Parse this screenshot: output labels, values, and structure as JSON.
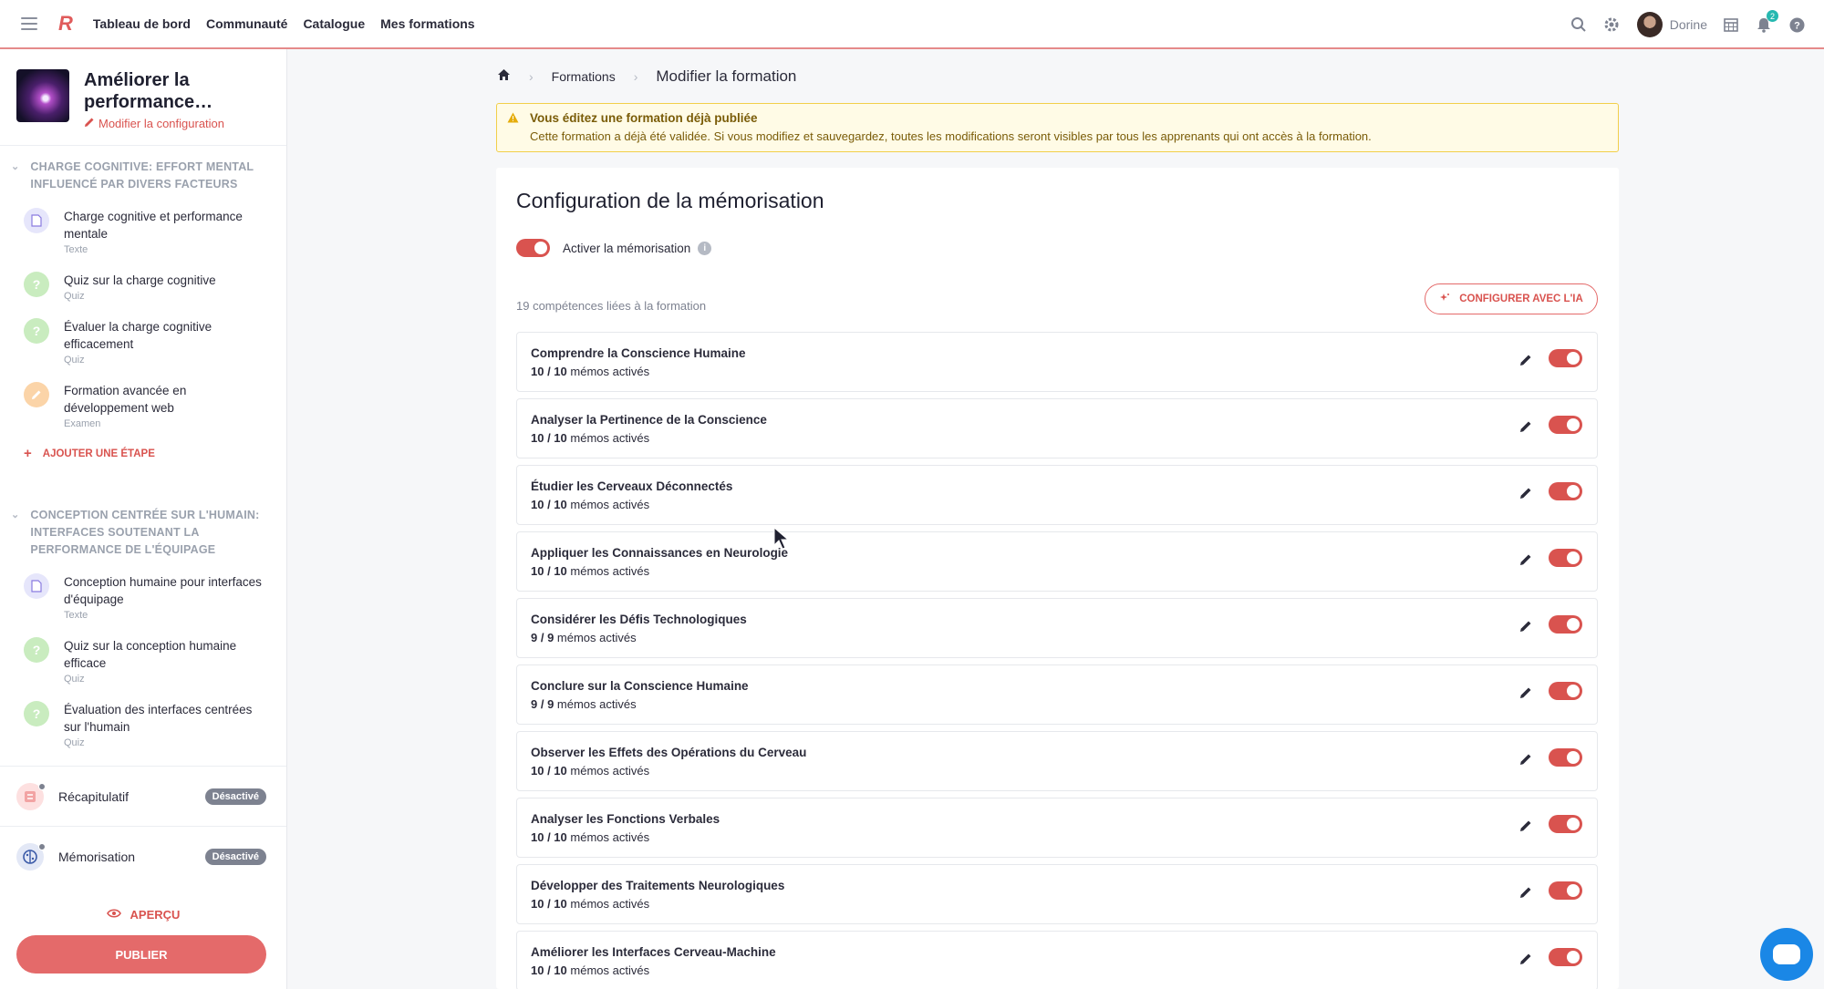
{
  "topbar": {
    "logo": "R",
    "nav": [
      "Tableau de bord",
      "Communauté",
      "Catalogue",
      "Mes formations"
    ],
    "username": "Dorine",
    "notifications_count": "2"
  },
  "sidebar": {
    "course_title": "Améliorer la performance…",
    "config_link": "Modifier la configuration",
    "chapters": [
      {
        "title": "Charge cognitive: effort mental influencé par divers facteurs",
        "steps": [
          {
            "label": "Charge cognitive et performance mentale",
            "type": "Texte",
            "icon": "document-icon"
          },
          {
            "label": "Quiz sur la charge cognitive",
            "type": "Quiz",
            "icon": "question-icon"
          },
          {
            "label": "Évaluer la charge cognitive efficacement",
            "type": "Quiz",
            "icon": "question-icon"
          },
          {
            "label": "Formation avancée en développement web",
            "type": "Examen",
            "icon": "pencil-icon"
          }
        ],
        "add_step": "Ajouter une étape"
      },
      {
        "title": "Conception centrée sur l'humain: interfaces soutenant la performance de l'équipage",
        "steps": [
          {
            "label": "Conception humaine pour interfaces d'équipage",
            "type": "Texte",
            "icon": "document-icon"
          },
          {
            "label": "Quiz sur la conception humaine efficace",
            "type": "Quiz",
            "icon": "question-icon"
          },
          {
            "label": "Évaluation des interfaces centrées sur l'humain",
            "type": "Quiz",
            "icon": "question-icon"
          }
        ]
      }
    ],
    "recap": {
      "label": "Récapitulatif",
      "badge": "Désactivé"
    },
    "memorisation": {
      "label": "Mémorisation",
      "badge": "Désactivé"
    },
    "preview": "Aperçu",
    "publish": "Publier"
  },
  "breadcrumb": {
    "section": "Formations",
    "current": "Modifier la formation"
  },
  "warning": {
    "title": "Vous éditez une formation déjà publiée",
    "text": "Cette formation a déjà été validée. Si vous modifiez et sauvegardez, toutes les modifications seront visibles par tous les apprenants qui ont accès à la formation."
  },
  "main": {
    "title": "Configuration de la mémorisation",
    "activate_label": "Activer la mémorisation",
    "activate_on": true,
    "skills_count": "19 compétences liées à la formation",
    "ai_button": "Configurer avec l'IA",
    "memos_suffix": "mémos activés",
    "skills": [
      {
        "name": "Comprendre la Conscience Humaine",
        "memos": "10 / 10",
        "enabled": true
      },
      {
        "name": "Analyser la Pertinence de la Conscience",
        "memos": "10 / 10",
        "enabled": true
      },
      {
        "name": "Étudier les Cerveaux Déconnectés",
        "memos": "10 / 10",
        "enabled": true
      },
      {
        "name": "Appliquer les Connaissances en Neurologie",
        "memos": "10 / 10",
        "enabled": true
      },
      {
        "name": "Considérer les Défis Technologiques",
        "memos": "9 / 9",
        "enabled": true
      },
      {
        "name": "Conclure sur la Conscience Humaine",
        "memos": "9 / 9",
        "enabled": true
      },
      {
        "name": "Observer les Effets des Opérations du Cerveau",
        "memos": "10 / 10",
        "enabled": true
      },
      {
        "name": "Analyser les Fonctions Verbales",
        "memos": "10 / 10",
        "enabled": true
      },
      {
        "name": "Développer des Traitements Neurologiques",
        "memos": "10 / 10",
        "enabled": true
      },
      {
        "name": "Améliorer les Interfaces Cerveau-Machine",
        "memos": "10 / 10",
        "enabled": true
      }
    ]
  },
  "colors": {
    "accent": "#d9534f",
    "warning_bg": "#fffbe6",
    "warning_border": "#f2cf4a",
    "chat": "#1a87e6"
  }
}
